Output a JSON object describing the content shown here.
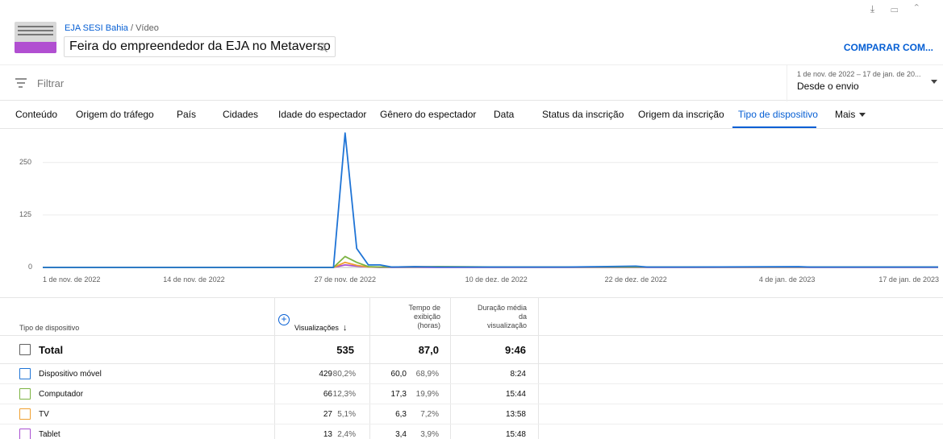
{
  "header": {
    "channel": "EJA SESI Bahia",
    "separator": "/",
    "crumb_label": "Vídeo",
    "video_title": "Feira do empreendedor da EJA no Metaverso",
    "compare_label": "COMPARAR COM..."
  },
  "filter": {
    "label": "Filtrar"
  },
  "date_range": {
    "range": "1 de nov. de 2022 – 17 de jan. de 20...",
    "preset": "Desde o envio"
  },
  "tabs": [
    {
      "label": "Conteúdo"
    },
    {
      "label": "Origem do tráfego"
    },
    {
      "label": "País"
    },
    {
      "label": "Cidades"
    },
    {
      "label": "Idade do espectador"
    },
    {
      "label": "Gênero do espectador"
    },
    {
      "label": "Data"
    },
    {
      "label": "Status da inscrição"
    },
    {
      "label": "Origem da inscrição"
    },
    {
      "label": "Tipo de dispositivo"
    },
    {
      "label": "Mais"
    }
  ],
  "active_tab": "Tipo de dispositivo",
  "chart_data": {
    "type": "line",
    "ylim": [
      0,
      330
    ],
    "yticks": [
      "0",
      "125",
      "250"
    ],
    "ytick_values": [
      0,
      125,
      250
    ],
    "xticks": [
      "1 de nov. de 2022",
      "14 de nov. de 2022",
      "27 de nov. de 2022",
      "10 de dez. de 2022",
      "22 de dez. de 2022",
      "4 de jan. de 2023",
      "17 de jan. de 2023"
    ],
    "xtick_days": [
      0,
      13,
      26,
      39,
      51,
      64,
      77
    ],
    "series": [
      {
        "name": "Dispositivo móvel",
        "color": "#1f74d6",
        "points": [
          [
            0,
            0
          ],
          [
            25,
            0
          ],
          [
            26,
            320
          ],
          [
            27,
            45
          ],
          [
            28,
            6
          ],
          [
            29,
            6
          ],
          [
            30,
            1
          ],
          [
            32,
            2
          ],
          [
            34,
            1
          ],
          [
            40,
            1
          ],
          [
            45,
            1
          ],
          [
            51,
            3
          ],
          [
            52,
            1
          ],
          [
            55,
            1
          ],
          [
            65,
            2
          ],
          [
            66,
            1
          ],
          [
            77,
            1
          ]
        ]
      },
      {
        "name": "Computador",
        "color": "#7cb342",
        "points": [
          [
            0,
            0
          ],
          [
            25,
            0
          ],
          [
            26,
            26
          ],
          [
            27,
            12
          ],
          [
            28,
            2
          ],
          [
            29,
            1
          ],
          [
            32,
            1
          ],
          [
            34,
            2
          ],
          [
            40,
            1
          ],
          [
            55,
            1
          ],
          [
            60,
            1
          ],
          [
            70,
            1
          ],
          [
            77,
            1
          ]
        ]
      },
      {
        "name": "TV",
        "color": "#f0a030",
        "points": [
          [
            0,
            0
          ],
          [
            25,
            0
          ],
          [
            26,
            12
          ],
          [
            27,
            5
          ],
          [
            28,
            1
          ],
          [
            30,
            1
          ],
          [
            32,
            2
          ],
          [
            40,
            1
          ],
          [
            50,
            1
          ],
          [
            77,
            1
          ]
        ]
      },
      {
        "name": "Tablet",
        "color": "#a94fd1",
        "points": [
          [
            0,
            0
          ],
          [
            25,
            0
          ],
          [
            26,
            6
          ],
          [
            27,
            3
          ],
          [
            28,
            1
          ],
          [
            29,
            0
          ],
          [
            77,
            0
          ]
        ]
      }
    ]
  },
  "table": {
    "headers": {
      "device": "Tipo de dispositivo",
      "views": "Visualizações",
      "watch_time_1": "Tempo de",
      "watch_time_2": "exibição",
      "watch_time_3": "(horas)",
      "avg_1": "Duração média",
      "avg_2": "da",
      "avg_3": "visualização"
    },
    "total": {
      "label": "Total",
      "views": "535",
      "watch": "87,0",
      "avg": "9:46"
    },
    "rows": [
      {
        "label": "Dispositivo móvel",
        "views": "429",
        "views_pct": "80,2%",
        "watch": "60,0",
        "watch_pct": "68,9%",
        "avg": "8:24",
        "color": "#1f74d6"
      },
      {
        "label": "Computador",
        "views": "66",
        "views_pct": "12,3%",
        "watch": "17,3",
        "watch_pct": "19,9%",
        "avg": "15:44",
        "color": "#7cb342"
      },
      {
        "label": "TV",
        "views": "27",
        "views_pct": "5,1%",
        "watch": "6,3",
        "watch_pct": "7,2%",
        "avg": "13:58",
        "color": "#f0a030"
      },
      {
        "label": "Tablet",
        "views": "13",
        "views_pct": "2,4%",
        "watch": "3,4",
        "watch_pct": "3,9%",
        "avg": "15:48",
        "color": "#a94fd1"
      }
    ]
  }
}
